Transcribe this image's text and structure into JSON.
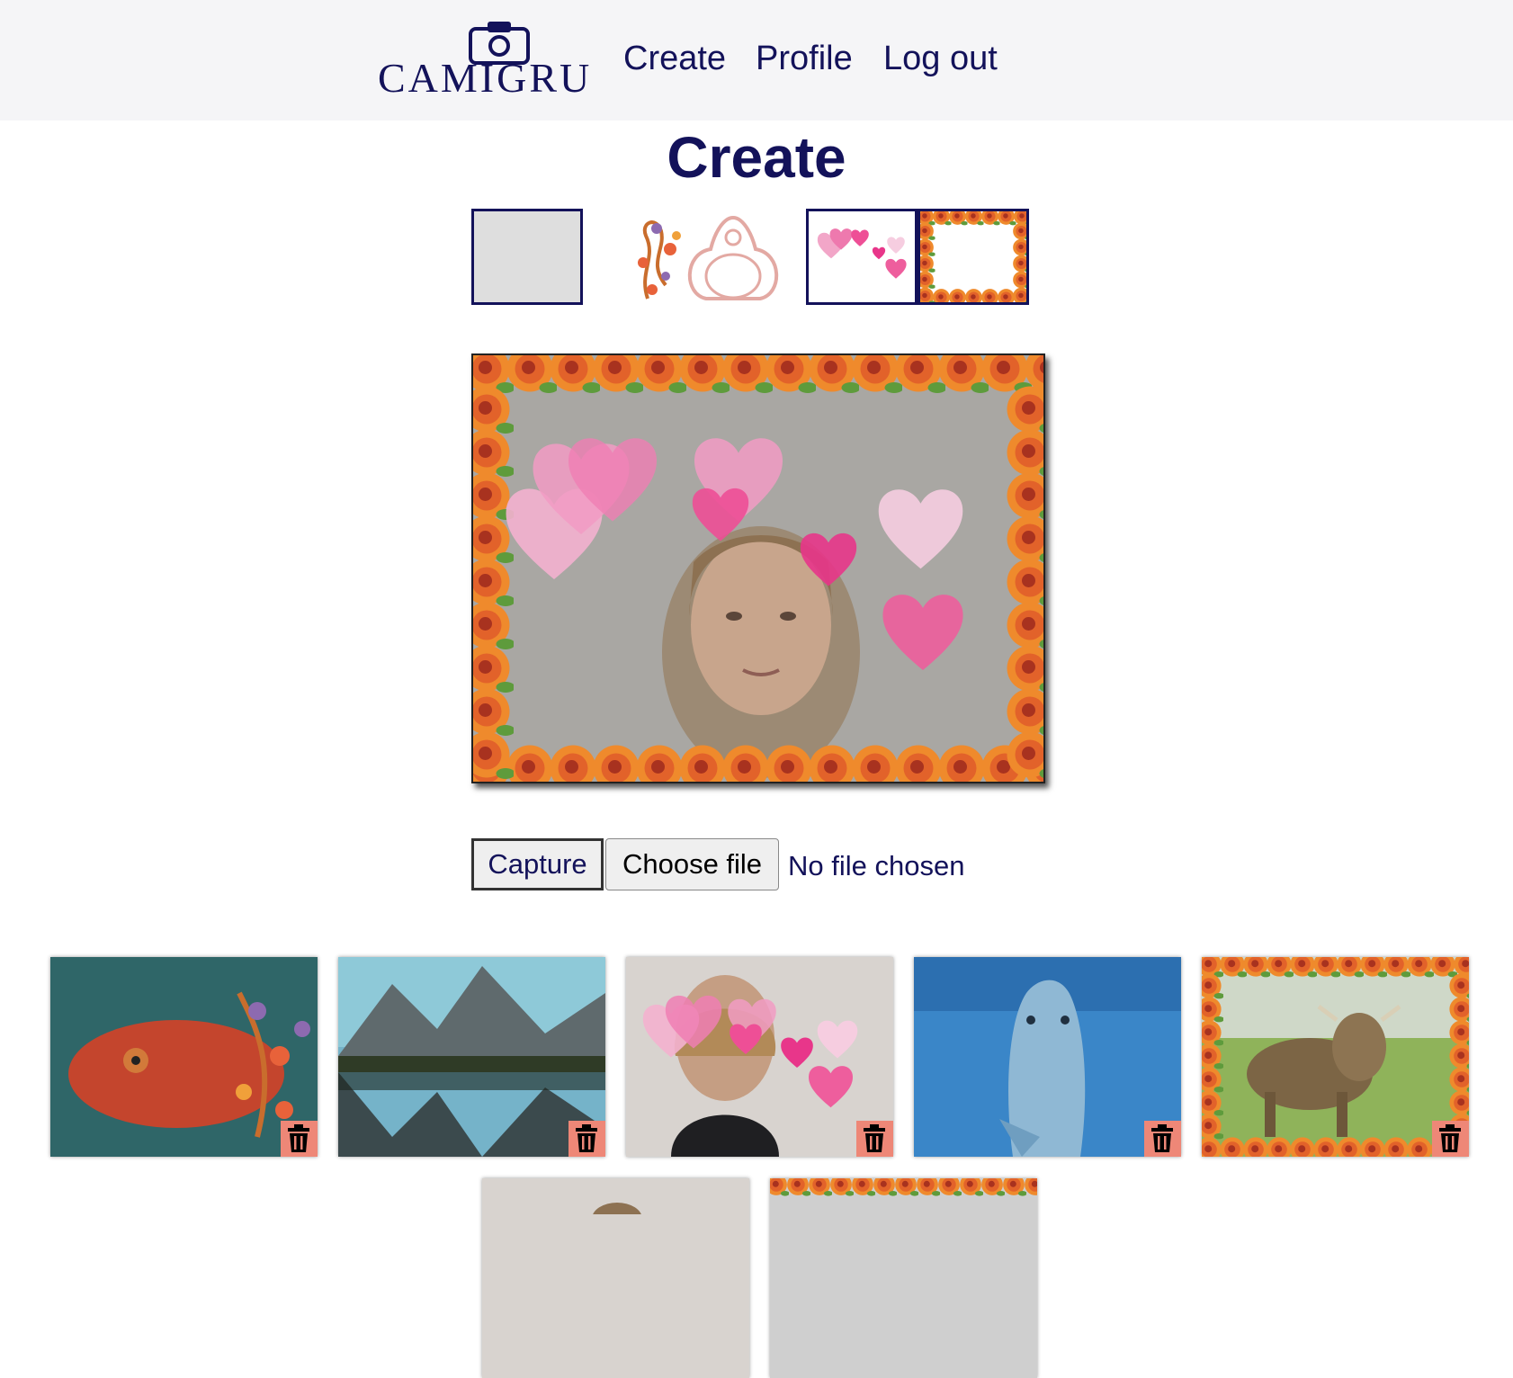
{
  "brand": {
    "name": "CAMIGRU",
    "logo_icon": "camera-icon"
  },
  "nav": {
    "create": "Create",
    "profile": "Profile",
    "logout": "Log out"
  },
  "page": {
    "title": "Create"
  },
  "filters": [
    {
      "name": "plain",
      "selected": true
    },
    {
      "name": "swirl-frame",
      "selected": false
    },
    {
      "name": "hearts",
      "selected": true
    },
    {
      "name": "roses-frame",
      "selected": true
    }
  ],
  "controls": {
    "capture_label": "Capture",
    "file_button_label": "Choose file",
    "file_status": "No file chosen"
  },
  "gallery": {
    "items": [
      {
        "subject": "chameleon",
        "delete_icon": "trash-icon"
      },
      {
        "subject": "mountain-lake",
        "delete_icon": "trash-icon"
      },
      {
        "subject": "woman-with-hearts",
        "delete_icon": "trash-icon"
      },
      {
        "subject": "dolphin",
        "delete_icon": "trash-icon"
      },
      {
        "subject": "cow-with-roses",
        "delete_icon": "trash-icon"
      },
      {
        "subject": "woman-partial"
      },
      {
        "subject": "roses-partial"
      }
    ]
  },
  "colors": {
    "primary": "#13125a",
    "nav_bg": "#f5f5f7",
    "delete_bg": "#ee8777"
  }
}
